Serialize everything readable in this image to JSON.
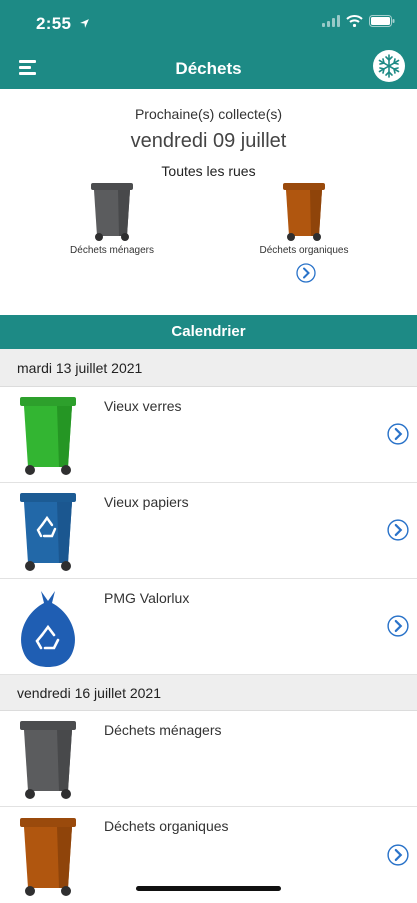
{
  "status_bar": {
    "time": "2:55"
  },
  "nav": {
    "title": "Déchets"
  },
  "next_collection": {
    "heading": "Prochaine(s) collecte(s)",
    "date": "vendredi 09 juillet",
    "street": "Toutes les rues",
    "bins": [
      {
        "label": "Déchets ménagers",
        "color": "#5b5c5e"
      },
      {
        "label": "Déchets organiques",
        "color": "#b0560f"
      }
    ]
  },
  "calendar": {
    "title": "Calendrier",
    "groups": [
      {
        "date": "mardi 13 juillet 2021",
        "items": [
          {
            "label": "Vieux verres",
            "icon": "green-bin-icon",
            "color": "#33b532"
          },
          {
            "label": "Vieux papiers",
            "icon": "blue-recycle-bin-icon",
            "color": "#2268a8"
          },
          {
            "label": "PMG Valorlux",
            "icon": "blue-recycle-bag-icon",
            "color": "#1f5eb3"
          }
        ]
      },
      {
        "date": "vendredi 16 juillet 2021",
        "items": [
          {
            "label": "Déchets ménagers",
            "icon": "gray-bin-icon",
            "color": "#5b5c5e"
          },
          {
            "label": "Déchets organiques",
            "icon": "brown-bin-icon",
            "color": "#b0560f"
          }
        ]
      }
    ]
  },
  "colors": {
    "header": "#1d8a85",
    "arrow": "#2a73c9"
  }
}
